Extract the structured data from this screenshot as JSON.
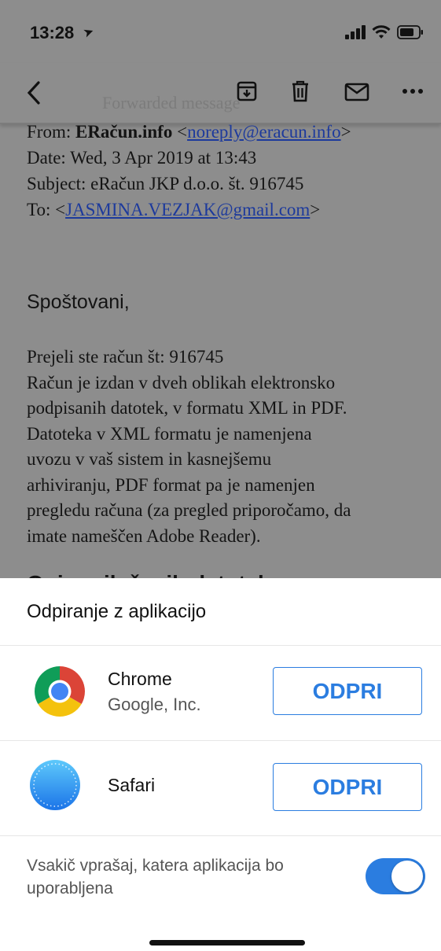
{
  "status_bar": {
    "time": "13:28"
  },
  "email": {
    "faded_label": "Forwarded message",
    "from_label": "From: ",
    "from_name": "ERačun.info",
    "from_email": "noreply@eracun.info",
    "date": "Date: Wed, 3 Apr 2019 at 13:43",
    "subject": "Subject: eRačun JKP d.o.o. št. 916745",
    "to_label": "To: ",
    "to_email": "JASMINA.VEZJAK@gmail.com",
    "greeting": "Spoštovani,",
    "body_lines": [
      "Prejeli ste račun št: 916745",
      "Račun je izdan v dveh oblikah elektronsko",
      "podpisanih datotek, v formatu XML in PDF.",
      "Datoteka v XML formatu je namenjena",
      "uvozu v vaš sistem in kasnejšemu",
      "arhiviranju, PDF format pa je namenjen",
      "pregledu računa (za pregled priporočamo, da",
      "imate nameščen Adobe Reader)."
    ],
    "cut_heading": "Opis priloženih datotek"
  },
  "sheet": {
    "title": "Odpiranje z aplikacijo",
    "apps": [
      {
        "name": "Chrome",
        "developer": "Google, Inc.",
        "button": "ODPRI",
        "icon": "chrome-icon"
      },
      {
        "name": "Safari",
        "developer": "",
        "button": "ODPRI",
        "icon": "safari-icon"
      }
    ],
    "ask_label": "Vsakič vprašaj, katera aplikacija bo uporabljena",
    "ask_toggle_on": true
  },
  "colors": {
    "accent": "#2b7de0",
    "link": "#1d3a9c"
  }
}
